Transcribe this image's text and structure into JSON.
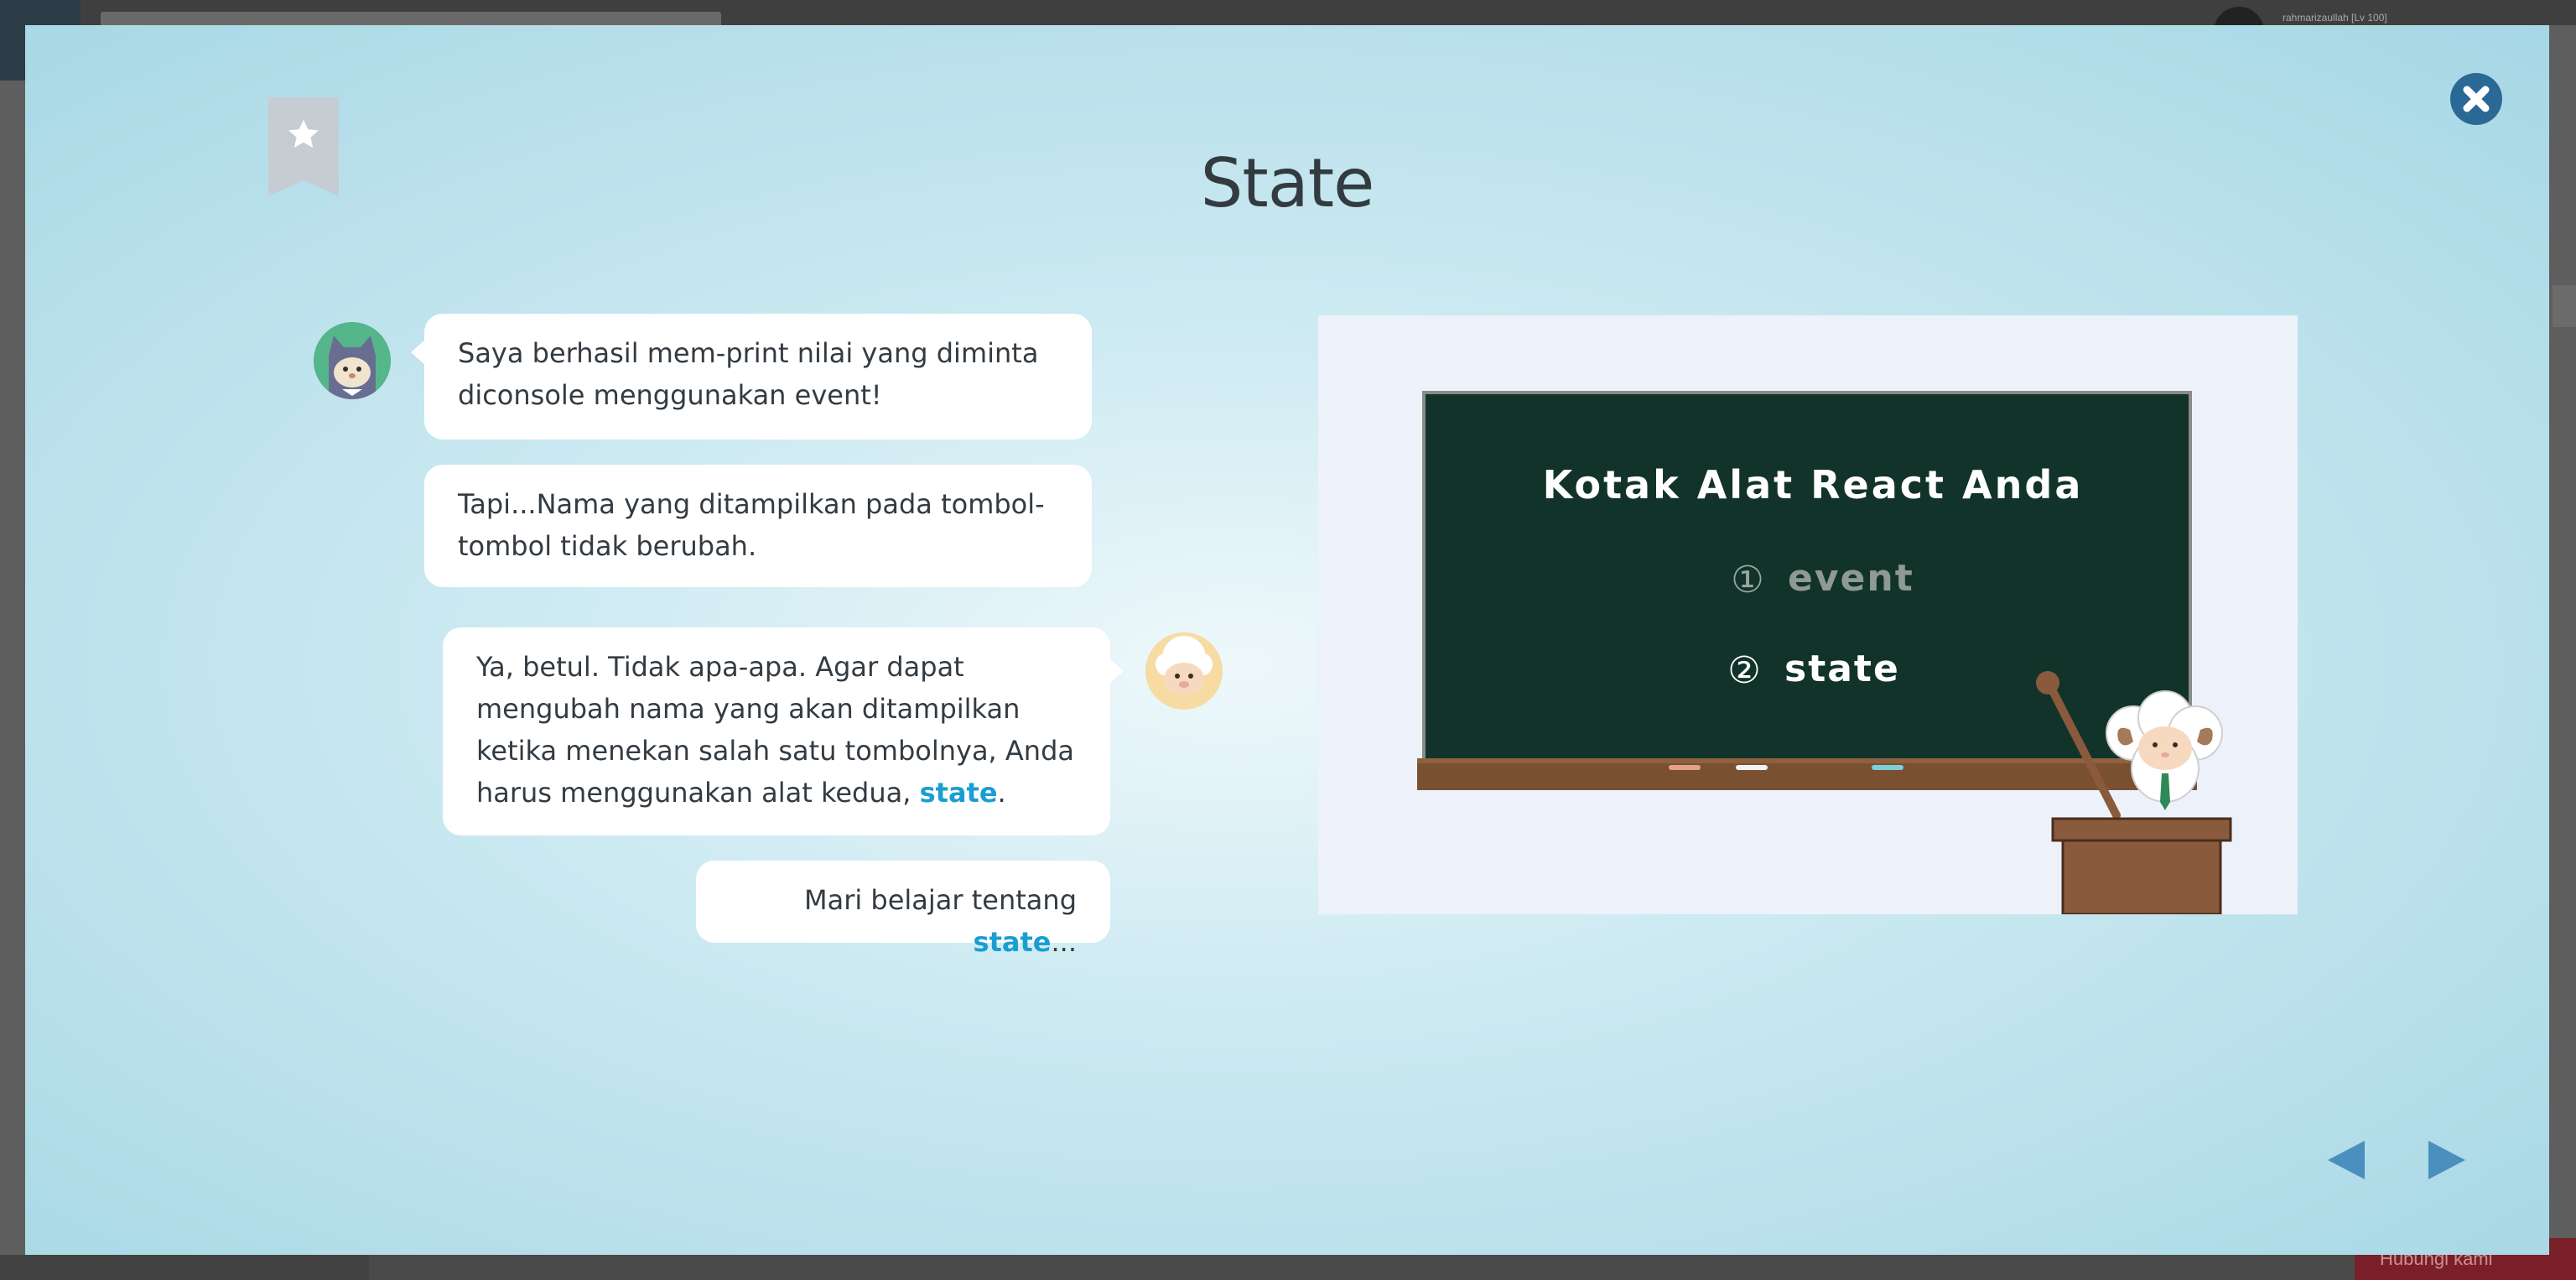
{
  "background": {
    "username": "rahmarizaullah [Lv 100]",
    "bottom_button": "Hubungi kami"
  },
  "lesson": {
    "title": "State",
    "bookmark_icon": "star-icon",
    "close_icon": "close-icon"
  },
  "dialog": [
    {
      "speaker": "cat-avatar",
      "text": "Saya berhasil mem-print nilai yang diminta diconsole menggunakan event!"
    },
    {
      "speaker": "cat-avatar",
      "text": "Tapi...Nama yang ditampilkan pada tombol-tombol tidak berubah."
    },
    {
      "speaker": "sheep-avatar",
      "text_before": "Ya, betul. Tidak apa-apa. Agar dapat mengubah nama yang akan ditampilkan ketika menekan salah satu tombolnya, Anda harus menggunakan alat kedua, ",
      "highlight": "state",
      "text_after": "."
    },
    {
      "speaker": "sheep-avatar",
      "text_before": "Mari belajar tentang ",
      "highlight": "state",
      "text_after": "..."
    }
  ],
  "blackboard": {
    "heading": "Kotak Alat React Anda",
    "items": [
      {
        "num": "①",
        "label": "event",
        "active": false
      },
      {
        "num": "②",
        "label": "state",
        "active": true
      }
    ]
  },
  "navigation": {
    "prev_icon": "triangle-left-icon",
    "next_icon": "triangle-right-icon"
  },
  "colors": {
    "highlight": "#1a9ed2",
    "close_button": "#2a6995",
    "board": "#11332a",
    "nav_arrow": "#4a8fbd"
  }
}
